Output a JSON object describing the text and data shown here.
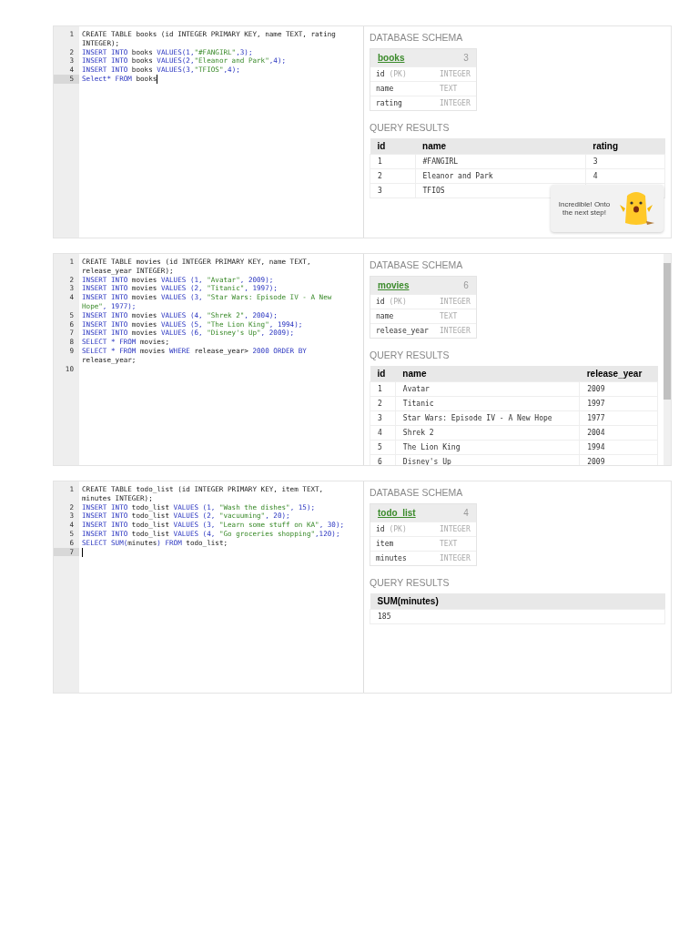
{
  "panels": [
    {
      "editor": {
        "lines": [
          {
            "number": "1",
            "active": false,
            "cursor": false,
            "tokens": [
              {
                "t": "CREATE TABLE books (id INTEGER PRIMARY KEY, name TEXT, rating INTEGER);",
                "kind": "plain"
              }
            ]
          },
          {
            "number": "2",
            "active": false,
            "cursor": false,
            "tokens": [
              {
                "t": "INSERT INTO",
                "kind": "kw"
              },
              {
                "t": " books ",
                "kind": "plain"
              },
              {
                "t": "VALUES(1,",
                "kind": "kw"
              },
              {
                "t": "\"#FANGIRL\"",
                "kind": "str"
              },
              {
                "t": ",3);",
                "kind": "kw"
              }
            ]
          },
          {
            "number": "3",
            "active": false,
            "cursor": false,
            "tokens": [
              {
                "t": "INSERT INTO",
                "kind": "kw"
              },
              {
                "t": " books ",
                "kind": "plain"
              },
              {
                "t": "VALUES(2,",
                "kind": "kw"
              },
              {
                "t": "\"Eleanor and Park\"",
                "kind": "str"
              },
              {
                "t": ",4);",
                "kind": "kw"
              }
            ]
          },
          {
            "number": "4",
            "active": false,
            "cursor": false,
            "tokens": [
              {
                "t": "INSERT INTO",
                "kind": "kw"
              },
              {
                "t": " books ",
                "kind": "plain"
              },
              {
                "t": "VALUES(3,",
                "kind": "kw"
              },
              {
                "t": "\"TFIOS\"",
                "kind": "str"
              },
              {
                "t": ",4);",
                "kind": "kw"
              }
            ]
          },
          {
            "number": "5",
            "active": true,
            "cursor": true,
            "tokens": [
              {
                "t": "Select* FROM",
                "kind": "kw"
              },
              {
                "t": " books",
                "kind": "plain"
              }
            ]
          }
        ]
      },
      "schema_title": "DATABASE SCHEMA",
      "table": {
        "name": "books",
        "count": "3",
        "columns": [
          {
            "name": "id",
            "pk": "(PK)",
            "type": "INTEGER"
          },
          {
            "name": "name",
            "type": "TEXT"
          },
          {
            "name": "rating",
            "type": "INTEGER"
          }
        ]
      },
      "results_title": "QUERY RESULTS",
      "results": {
        "columns": [
          "id",
          "name",
          "rating"
        ],
        "rows": [
          [
            "1",
            "#FANGIRL",
            "3"
          ],
          [
            "2",
            "Eleanor and Park",
            "4"
          ],
          [
            "3",
            "TFIOS",
            ""
          ]
        ]
      },
      "scrollbar": false,
      "tooltip": {
        "text": "Incredible! Onto the next step!"
      }
    },
    {
      "editor": {
        "lines": [
          {
            "number": "1",
            "active": false,
            "cursor": false,
            "tokens": [
              {
                "t": "CREATE TABLE movies (id INTEGER PRIMARY KEY, name TEXT, release_year INTEGER);",
                "kind": "plain"
              }
            ]
          },
          {
            "number": "2",
            "active": false,
            "cursor": false,
            "tokens": [
              {
                "t": "INSERT INTO",
                "kind": "kw"
              },
              {
                "t": " movies ",
                "kind": "plain"
              },
              {
                "t": "VALUES (1, ",
                "kind": "kw"
              },
              {
                "t": "\"Avatar\"",
                "kind": "str"
              },
              {
                "t": ", 2009);",
                "kind": "kw"
              }
            ]
          },
          {
            "number": "3",
            "active": false,
            "cursor": false,
            "tokens": [
              {
                "t": "INSERT INTO",
                "kind": "kw"
              },
              {
                "t": " movies ",
                "kind": "plain"
              },
              {
                "t": "VALUES (2, ",
                "kind": "kw"
              },
              {
                "t": "\"Titanic\"",
                "kind": "str"
              },
              {
                "t": ", 1997);",
                "kind": "kw"
              }
            ]
          },
          {
            "number": "4",
            "active": false,
            "cursor": false,
            "tokens": [
              {
                "t": "INSERT INTO",
                "kind": "kw"
              },
              {
                "t": " movies ",
                "kind": "plain"
              },
              {
                "t": "VALUES (3, ",
                "kind": "kw"
              },
              {
                "t": "\"Star Wars: Episode IV - A New Hope\"",
                "kind": "str"
              },
              {
                "t": ", 1977);",
                "kind": "kw"
              }
            ]
          },
          {
            "number": "5",
            "active": false,
            "cursor": false,
            "tokens": [
              {
                "t": "INSERT INTO",
                "kind": "kw"
              },
              {
                "t": " movies ",
                "kind": "plain"
              },
              {
                "t": "VALUES (4, ",
                "kind": "kw"
              },
              {
                "t": "\"Shrek 2\"",
                "kind": "str"
              },
              {
                "t": ", 2004);",
                "kind": "kw"
              }
            ]
          },
          {
            "number": "6",
            "active": false,
            "cursor": false,
            "tokens": [
              {
                "t": "INSERT INTO",
                "kind": "kw"
              },
              {
                "t": " movies ",
                "kind": "plain"
              },
              {
                "t": "VALUES (5, ",
                "kind": "kw"
              },
              {
                "t": "\"The Lion King\"",
                "kind": "str"
              },
              {
                "t": ", 1994);",
                "kind": "kw"
              }
            ]
          },
          {
            "number": "7",
            "active": false,
            "cursor": false,
            "tokens": [
              {
                "t": "INSERT INTO",
                "kind": "kw"
              },
              {
                "t": " movies ",
                "kind": "plain"
              },
              {
                "t": "VALUES (6, ",
                "kind": "kw"
              },
              {
                "t": "\"Disney's Up\"",
                "kind": "str"
              },
              {
                "t": ", 2009);",
                "kind": "kw"
              }
            ]
          },
          {
            "number": "8",
            "active": false,
            "cursor": false,
            "tokens": [
              {
                "t": "SELECT * FROM",
                "kind": "kw"
              },
              {
                "t": " movies;",
                "kind": "plain"
              }
            ]
          },
          {
            "number": "9",
            "active": false,
            "cursor": false,
            "tokens": [
              {
                "t": "SELECT * FROM",
                "kind": "kw"
              },
              {
                "t": " movies ",
                "kind": "plain"
              },
              {
                "t": "WHERE",
                "kind": "kw"
              },
              {
                "t": " release_year> ",
                "kind": "plain"
              },
              {
                "t": "2000 ORDER BY",
                "kind": "kw"
              },
              {
                "t": " release_year;",
                "kind": "plain"
              }
            ]
          },
          {
            "number": "10",
            "active": false,
            "cursor": false
          }
        ]
      },
      "schema_title": "DATABASE SCHEMA",
      "table": {
        "name": "movies",
        "count": "6",
        "columns": [
          {
            "name": "id",
            "pk": "(PK)",
            "type": "INTEGER"
          },
          {
            "name": "name",
            "type": "TEXT"
          },
          {
            "name": "release_year",
            "type": "INTEGER"
          }
        ]
      },
      "results_title": "QUERY RESULTS",
      "results": {
        "columns": [
          "id",
          "name",
          "release_year"
        ],
        "rows": [
          [
            "1",
            "Avatar",
            "2009"
          ],
          [
            "2",
            "Titanic",
            "1997"
          ],
          [
            "3",
            "Star Wars: Episode IV - A New Hope",
            "1977"
          ],
          [
            "4",
            "Shrek 2",
            "2004"
          ],
          [
            "5",
            "The Lion King",
            "1994"
          ],
          [
            "6",
            "Disney's Up",
            "2009"
          ]
        ]
      },
      "scrollbar": true
    },
    {
      "editor": {
        "lines": [
          {
            "number": "1",
            "active": false,
            "cursor": false,
            "tokens": [
              {
                "t": "CREATE TABLE todo_list (id INTEGER PRIMARY KEY, item TEXT, minutes INTEGER);",
                "kind": "plain"
              }
            ]
          },
          {
            "number": "2",
            "active": false,
            "cursor": false,
            "tokens": [
              {
                "t": "INSERT INTO",
                "kind": "kw"
              },
              {
                "t": " todo_list ",
                "kind": "plain"
              },
              {
                "t": "VALUES (1, ",
                "kind": "kw"
              },
              {
                "t": "\"Wash the dishes\"",
                "kind": "str"
              },
              {
                "t": ", 15);",
                "kind": "kw"
              }
            ]
          },
          {
            "number": "3",
            "active": false,
            "cursor": false,
            "tokens": [
              {
                "t": "INSERT INTO",
                "kind": "kw"
              },
              {
                "t": " todo_list ",
                "kind": "plain"
              },
              {
                "t": "VALUES (2, ",
                "kind": "kw"
              },
              {
                "t": "\"vacuuming\"",
                "kind": "str"
              },
              {
                "t": ", 20);",
                "kind": "kw"
              }
            ]
          },
          {
            "number": "4",
            "active": false,
            "cursor": false,
            "tokens": [
              {
                "t": "INSERT INTO",
                "kind": "kw"
              },
              {
                "t": " todo_list ",
                "kind": "plain"
              },
              {
                "t": "VALUES (3, ",
                "kind": "kw"
              },
              {
                "t": "\"Learn some stuff on KA\"",
                "kind": "str"
              },
              {
                "t": ", 30);",
                "kind": "kw"
              }
            ]
          },
          {
            "number": "5",
            "active": false,
            "cursor": false,
            "tokens": [
              {
                "t": "INSERT INTO",
                "kind": "kw"
              },
              {
                "t": " todo_list ",
                "kind": "plain"
              },
              {
                "t": "VALUES (4, ",
                "kind": "kw"
              },
              {
                "t": "\"Go groceries shopping\"",
                "kind": "str"
              },
              {
                "t": ",120);",
                "kind": "kw"
              }
            ]
          },
          {
            "number": "6",
            "active": false,
            "cursor": false,
            "tokens": [
              {
                "t": "SELECT SUM(",
                "kind": "kw"
              },
              {
                "t": "minutes",
                "kind": "plain"
              },
              {
                "t": ") FROM",
                "kind": "kw"
              },
              {
                "t": " todo_list;",
                "kind": "plain"
              }
            ]
          },
          {
            "number": "7",
            "active": true,
            "cursor": true
          }
        ]
      },
      "schema_title": "DATABASE SCHEMA",
      "table": {
        "name": "todo_list",
        "count": "4",
        "columns": [
          {
            "name": "id",
            "pk": "(PK)",
            "type": "INTEGER"
          },
          {
            "name": "item",
            "type": "TEXT"
          },
          {
            "name": "minutes",
            "type": "INTEGER"
          }
        ]
      },
      "results_title": "QUERY RESULTS",
      "results": {
        "columns": [
          "SUM(minutes)"
        ],
        "rows": [
          [
            "185"
          ]
        ]
      },
      "scrollbar": false
    }
  ]
}
